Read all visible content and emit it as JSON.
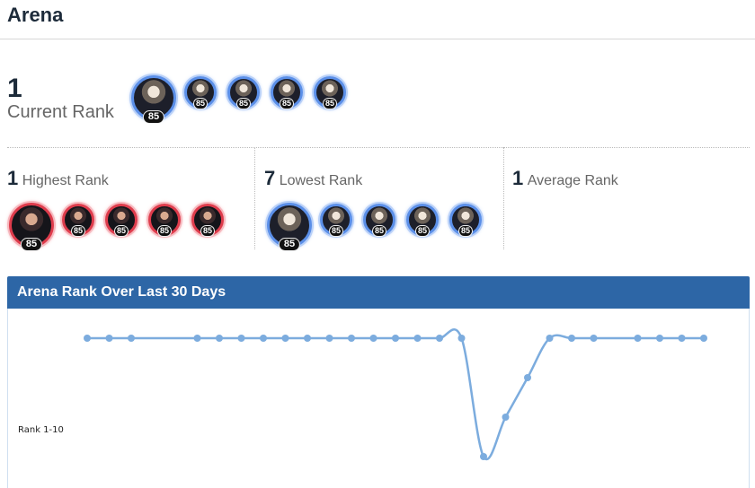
{
  "page_title": "Arena",
  "current": {
    "rank": "1",
    "label": "Current Rank",
    "team": [
      {
        "level": "85",
        "icon": "character-portrait-icon",
        "color": "#5b8fe8"
      },
      {
        "level": "85",
        "icon": "character-portrait-icon",
        "color": "#5b8fe8"
      },
      {
        "level": "85",
        "icon": "character-portrait-icon",
        "color": "#5b8fe8"
      },
      {
        "level": "85",
        "icon": "character-portrait-icon",
        "color": "#5b8fe8"
      },
      {
        "level": "85",
        "icon": "character-portrait-icon",
        "color": "#5b8fe8"
      }
    ]
  },
  "highest": {
    "rank": "1",
    "label": "Highest Rank",
    "team": [
      {
        "level": "85",
        "icon": "character-portrait-icon",
        "color": "#de3c4c"
      },
      {
        "level": "85",
        "icon": "character-portrait-icon",
        "color": "#de3c4c"
      },
      {
        "level": "85",
        "icon": "character-portrait-icon",
        "color": "#de3c4c"
      },
      {
        "level": "85",
        "icon": "character-portrait-icon",
        "color": "#de3c4c"
      },
      {
        "level": "85",
        "icon": "character-portrait-icon",
        "color": "#de3c4c"
      }
    ]
  },
  "lowest": {
    "rank": "7",
    "label": "Lowest Rank",
    "team": [
      {
        "level": "85",
        "icon": "character-portrait-icon",
        "color": "#5b8fe8"
      },
      {
        "level": "85",
        "icon": "character-portrait-icon",
        "color": "#5b8fe8"
      },
      {
        "level": "85",
        "icon": "character-portrait-icon",
        "color": "#5b8fe8"
      },
      {
        "level": "85",
        "icon": "character-portrait-icon",
        "color": "#5b8fe8"
      },
      {
        "level": "85",
        "icon": "character-portrait-icon",
        "color": "#5b8fe8"
      }
    ]
  },
  "average": {
    "rank": "1",
    "label": "Average Rank"
  },
  "rank_chart": {
    "title": "Arena Rank Over Last 30 Days",
    "header_color": "#2d66a6",
    "line_color": "#7cacde",
    "chart_data": {
      "type": "line",
      "title": "Arena Rank Over Last 30 Days",
      "y_tick_labels": [
        "Rank 1-10"
      ],
      "y_axis": "rank",
      "y_inverted": true,
      "series": [
        {
          "points": [
            {
              "x": 0,
              "y": 1
            },
            {
              "x": 1,
              "y": 1
            },
            {
              "x": 2,
              "y": 1
            },
            {
              "x": 5,
              "y": 1
            },
            {
              "x": 6,
              "y": 1
            },
            {
              "x": 7,
              "y": 1
            },
            {
              "x": 8,
              "y": 1
            },
            {
              "x": 9,
              "y": 1
            },
            {
              "x": 10,
              "y": 1
            },
            {
              "x": 11,
              "y": 1
            },
            {
              "x": 12,
              "y": 1
            },
            {
              "x": 13,
              "y": 1
            },
            {
              "x": 14,
              "y": 1
            },
            {
              "x": 15,
              "y": 1
            },
            {
              "x": 16,
              "y": 1
            },
            {
              "x": 17,
              "y": 1
            },
            {
              "x": 18,
              "y": 7
            },
            {
              "x": 19,
              "y": 5
            },
            {
              "x": 20,
              "y": 3
            },
            {
              "x": 21,
              "y": 1
            },
            {
              "x": 22,
              "y": 1
            },
            {
              "x": 23,
              "y": 1
            },
            {
              "x": 25,
              "y": 1
            },
            {
              "x": 26,
              "y": 1
            },
            {
              "x": 27,
              "y": 1
            },
            {
              "x": 28,
              "y": 1
            }
          ]
        }
      ]
    }
  }
}
